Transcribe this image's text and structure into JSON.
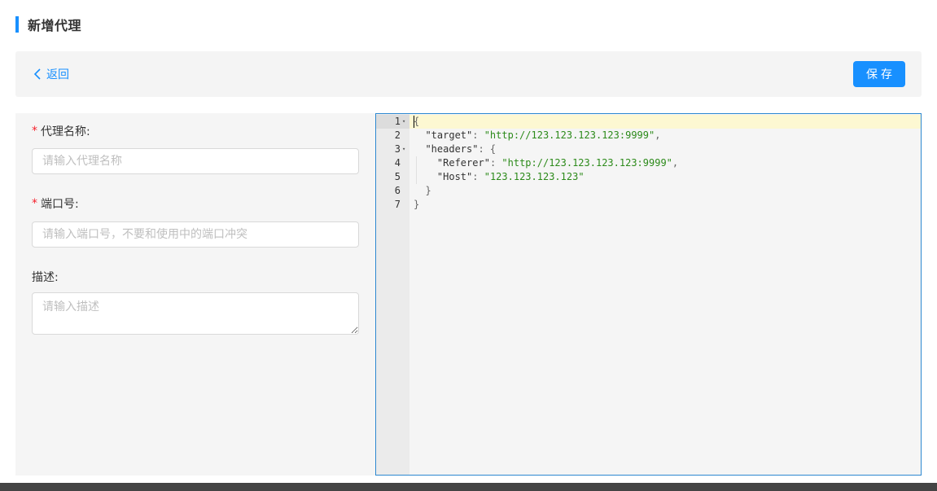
{
  "header": {
    "title": "新增代理"
  },
  "toolbar": {
    "back_label": "返回",
    "save_label": "保存"
  },
  "form": {
    "name_label": "代理名称:",
    "name_placeholder": "请输入代理名称",
    "port_label": "端口号:",
    "port_placeholder": "请输入端口号，不要和使用中的端口冲突",
    "desc_label": "描述:",
    "desc_placeholder": "请输入描述",
    "required_mark": "*"
  },
  "editor": {
    "lines": [
      {
        "num": "1",
        "fold": "▾",
        "indent": "",
        "parts": [
          [
            "p",
            "{"
          ]
        ]
      },
      {
        "num": "2",
        "fold": "",
        "indent": "  ",
        "parts": [
          [
            "k",
            "\"target\""
          ],
          [
            "p",
            ": "
          ],
          [
            "s",
            "\"http://123.123.123.123:9999\""
          ],
          [
            "p",
            ","
          ]
        ]
      },
      {
        "num": "3",
        "fold": "▾",
        "indent": "  ",
        "parts": [
          [
            "k",
            "\"headers\""
          ],
          [
            "p",
            ": {"
          ]
        ]
      },
      {
        "num": "4",
        "fold": "",
        "indent": "    ",
        "parts": [
          [
            "k",
            "\"Referer\""
          ],
          [
            "p",
            ": "
          ],
          [
            "s",
            "\"http://123.123.123.123:9999\""
          ],
          [
            "p",
            ","
          ]
        ]
      },
      {
        "num": "5",
        "fold": "",
        "indent": "    ",
        "parts": [
          [
            "k",
            "\"Host\""
          ],
          [
            "p",
            ": "
          ],
          [
            "s",
            "\"123.123.123.123\""
          ]
        ]
      },
      {
        "num": "6",
        "fold": "",
        "indent": "  ",
        "parts": [
          [
            "p",
            "}"
          ]
        ]
      },
      {
        "num": "7",
        "fold": "",
        "indent": "",
        "parts": [
          [
            "p",
            "}"
          ]
        ]
      }
    ]
  },
  "colors": {
    "accent": "#1890ff",
    "required": "#f5222d",
    "string": "#2c8a1a",
    "editor_border": "#2d88d0",
    "active_line": "#fdf8d2"
  }
}
